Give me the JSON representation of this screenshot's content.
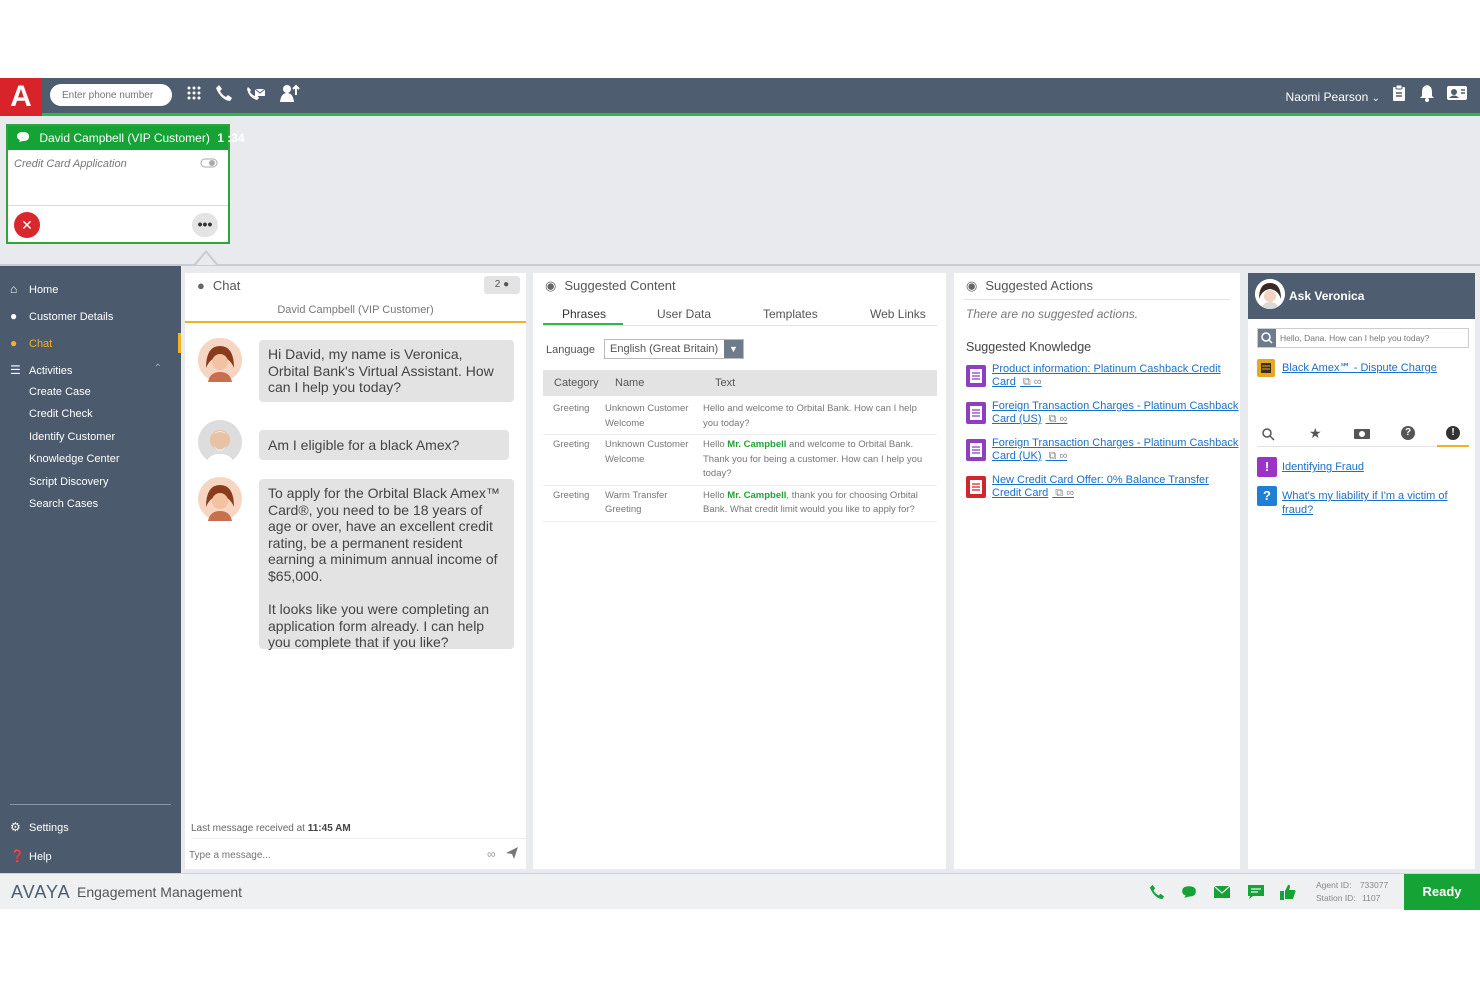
{
  "topbar": {
    "logo_text": "A",
    "phone_placeholder": "Enter phone number",
    "agent_name": "Naomi Pearson"
  },
  "interaction": {
    "title": "David Campbell (VIP Customer)",
    "timer": "1 :34",
    "subject": "Credit Card Application"
  },
  "sidebar": {
    "home": "Home",
    "customer_details": "Customer Details",
    "chat": "Chat",
    "activities": "Activities",
    "sub_items": [
      "Create Case",
      "Credit Check",
      "Identify Customer",
      "Knowledge Center",
      "Script Discovery",
      "Search Cases"
    ],
    "settings": "Settings",
    "help": "Help"
  },
  "chat": {
    "title": "Chat",
    "participants": "2",
    "customer": "David Campbell (VIP Customer)",
    "messages": [
      "Hi David, my name is Veronica, Orbital Bank's Virtual Assistant. How can I help you today?",
      "Am I eligible for a black Amex?",
      "To apply for the Orbital Black Amex™ Card®, you need to be 18 years of age or over, have an excellent credit rating, be a permanent resident earning a minimum annual income of $65,000.",
      "It looks like you were completing an application form already. I can help you complete that if you like?"
    ],
    "last_message_label": "Last message received at",
    "last_message_time": "11:45 AM",
    "input_placeholder": "Type a message..."
  },
  "suggested_content": {
    "title": "Suggested Content",
    "tabs": [
      "Phrases",
      "User Data",
      "Templates",
      "Web Links"
    ],
    "language_label": "Language",
    "language_value": "English (Great Britain)",
    "columns": [
      "Category",
      "Name",
      "Text"
    ],
    "rows": [
      {
        "category": "Greeting",
        "name": "Unknown Customer Welcome",
        "text_a": "Hello and welcome to Orbital Bank. How can I help you today?",
        "highlight": "",
        "text_b": ""
      },
      {
        "category": "Greeting",
        "name": "Unknown Customer Welcome",
        "text_a": "Hello",
        "highlight": "Mr. Campbell",
        "text_b": "and welcome to Orbital Bank. Thank you for being a customer. How can I help you today?"
      },
      {
        "category": "Greeting",
        "name": "Warm Transfer Greeting",
        "text_a": "Hello",
        "highlight": "Mr. Campbell",
        "text_b": ", thank you for choosing Orbital Bank. What credit limit would you like to apply for?"
      }
    ]
  },
  "suggested_actions": {
    "title": "Suggested Actions",
    "empty_text": "There are no suggested actions.",
    "knowledge_title": "Suggested Knowledge",
    "knowledge": [
      {
        "title": "Product information: Platinum Cashback Credit Card",
        "color": "#8e3fbf"
      },
      {
        "title": "Foreign Transaction Charges - Platinum Cashback Card (US)",
        "color": "#8e3fbf"
      },
      {
        "title": "Foreign Transaction Charges - Platinum Cashback Card (UK)",
        "color": "#8e3fbf"
      },
      {
        "title": "New Credit Card Offer: 0% Balance Transfer Credit Card",
        "color": "#d0262c"
      }
    ]
  },
  "ask_veronica": {
    "title": "Ask Veronica",
    "search_placeholder": "Hello, Dana. How can I help you today?",
    "top_result": "Black Amex℠ - Dispute Charge",
    "results": [
      {
        "label": "Identifying Fraud",
        "badge": "!",
        "color": "#9b34c4"
      },
      {
        "label": "What's my liability if I'm a victim of fraud?",
        "badge": "?",
        "color": "#1f7ed6"
      }
    ]
  },
  "footer": {
    "brand": "AVAYA",
    "product": "Engagement Management",
    "agent_id_label": "Agent ID:",
    "agent_id": "733077",
    "station_id_label": "Station ID:",
    "station_id": "1107",
    "status": "Ready"
  },
  "colors": {
    "accent_green": "#16a336",
    "brand_red": "#d8232a",
    "nav_bg": "#4b5a6c",
    "chat_active": "#f0b323",
    "link_blue": "#1a6fc9"
  }
}
